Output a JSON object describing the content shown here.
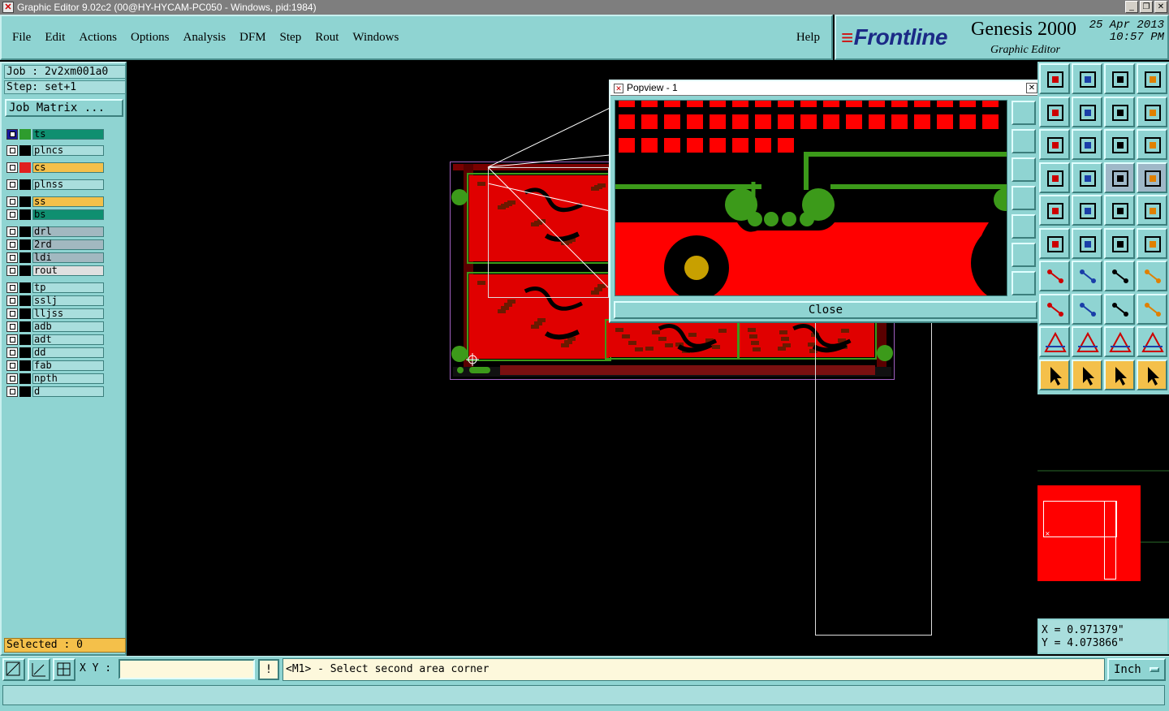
{
  "window": {
    "title": "Graphic Editor 9.02c2 (00@HY-HYCAM-PC050 - Windows, pid:1984)"
  },
  "menu": {
    "items": [
      "File",
      "Edit",
      "Actions",
      "Options",
      "Analysis",
      "DFM",
      "Step",
      "Rout",
      "Windows"
    ],
    "help": "Help"
  },
  "brand": {
    "logo": "Frontline",
    "product": "Genesis 2000",
    "subtitle": "Graphic Editor",
    "date": "25 Apr 2013",
    "time": "10:57 PM"
  },
  "job": {
    "job_label": "Job : 2v2xm001a0",
    "step_label": "Step: set+1",
    "matrix_button": "Job Matrix ..."
  },
  "layers": [
    {
      "name": "ts",
      "color": "#0f8f70",
      "swatch": "#2e9c2e",
      "checked": true
    },
    {
      "name": "plncs",
      "color": "#a9dedd",
      "swatch": "#000000",
      "checked": false
    },
    {
      "name": "cs",
      "color": "#f4c04a",
      "swatch": "#e02020",
      "checked": false
    },
    {
      "name": "plnss",
      "color": "#a9dedd",
      "swatch": "#000000",
      "checked": false
    },
    {
      "name": "ss",
      "color": "#f4c04a",
      "swatch": "#000000",
      "checked": false
    },
    {
      "name": "bs",
      "color": "#0f8f70",
      "swatch": "#000000",
      "checked": false
    },
    {
      "name": "drl",
      "color": "#a2b8c0",
      "swatch": "#000000",
      "checked": false
    },
    {
      "name": "2rd",
      "color": "#a2b8c0",
      "swatch": "#000000",
      "checked": false
    },
    {
      "name": "ldi",
      "color": "#a2b8c0",
      "swatch": "#000000",
      "checked": false
    },
    {
      "name": "rout",
      "color": "#e0e0e0",
      "swatch": "#000000",
      "checked": false
    },
    {
      "name": "tp",
      "color": "#a9dedd",
      "swatch": "#000000",
      "checked": false
    },
    {
      "name": "sslj",
      "color": "#a9dedd",
      "swatch": "#000000",
      "checked": false
    },
    {
      "name": "lljss",
      "color": "#a9dedd",
      "swatch": "#000000",
      "checked": false
    },
    {
      "name": "adb",
      "color": "#a9dedd",
      "swatch": "#000000",
      "checked": false
    },
    {
      "name": "adt",
      "color": "#a9dedd",
      "swatch": "#000000",
      "checked": false
    },
    {
      "name": "dd",
      "color": "#a9dedd",
      "swatch": "#000000",
      "checked": false
    },
    {
      "name": "fab",
      "color": "#a9dedd",
      "swatch": "#000000",
      "checked": false
    },
    {
      "name": "npth",
      "color": "#a9dedd",
      "swatch": "#000000",
      "checked": false
    },
    {
      "name": "d",
      "color": "#a9dedd",
      "swatch": "#000000",
      "checked": false
    }
  ],
  "selected_label": "Selected : 0",
  "popview": {
    "title": "Popview - 1",
    "close_label": "Close"
  },
  "coords": {
    "x": "X = 0.971379\"",
    "y": "Y = 4.073866\""
  },
  "bottom": {
    "xy_label": "X Y :",
    "xy_value": "",
    "prompt": "<M1> - Select second area corner",
    "units": "Inch",
    "exclaim": "!"
  },
  "colors": {
    "panel": "#8fd4d2",
    "copper": "#ff0000",
    "trace": "#3c9a1a",
    "outline": "#ffffff"
  }
}
